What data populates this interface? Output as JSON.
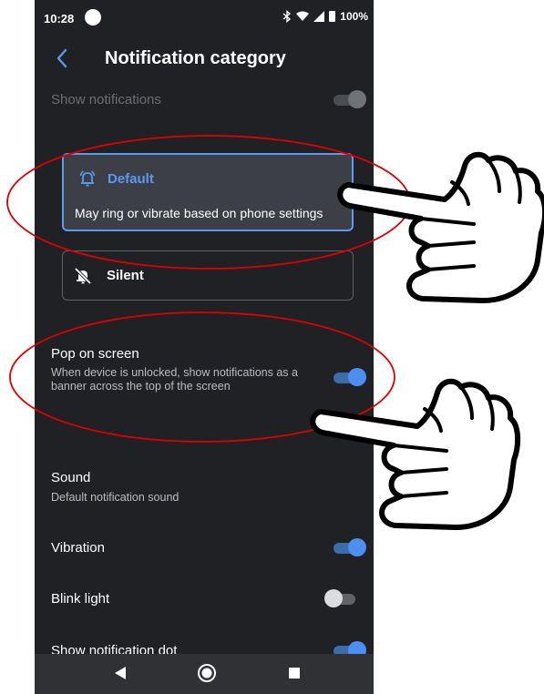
{
  "status_bar": {
    "time": "10:28",
    "battery": "100%",
    "icons": [
      "bluetooth-icon",
      "wifi-icon",
      "signal-icon",
      "battery-icon"
    ]
  },
  "app_bar": {
    "title": "Notification category",
    "back_icon": "chevron-left-icon"
  },
  "settings": {
    "show_notifications": {
      "title": "Show notifications",
      "enabled": true,
      "disabled": true
    },
    "behavior_options": [
      {
        "label": "Default",
        "description": "May ring or vibrate based on phone settings",
        "icon": "bell-ringing-icon",
        "selected": true
      },
      {
        "label": "Silent",
        "icon": "bell-off-icon",
        "selected": false
      }
    ],
    "pop_on_screen": {
      "title": "Pop on screen",
      "subtitle": "When device is unlocked, show notifications as a banner across the top of the screen",
      "enabled": true
    },
    "sound": {
      "title": "Sound",
      "subtitle": "Default notification sound"
    },
    "vibration": {
      "title": "Vibration",
      "enabled": true
    },
    "blink_light": {
      "title": "Blink light",
      "enabled": false
    },
    "notification_dot": {
      "title": "Show notification dot",
      "enabled": true
    }
  },
  "nav_bar": {
    "buttons": [
      "back-triangle-icon",
      "home-circle-icon",
      "recents-square-icon"
    ]
  },
  "annotations": {
    "ellipse_color": "#e00000",
    "hand_icon": "pointing-hand-icon"
  },
  "colors": {
    "background": "#202124",
    "accent": "#5c99f0",
    "text_secondary": "#b9bcc2"
  }
}
